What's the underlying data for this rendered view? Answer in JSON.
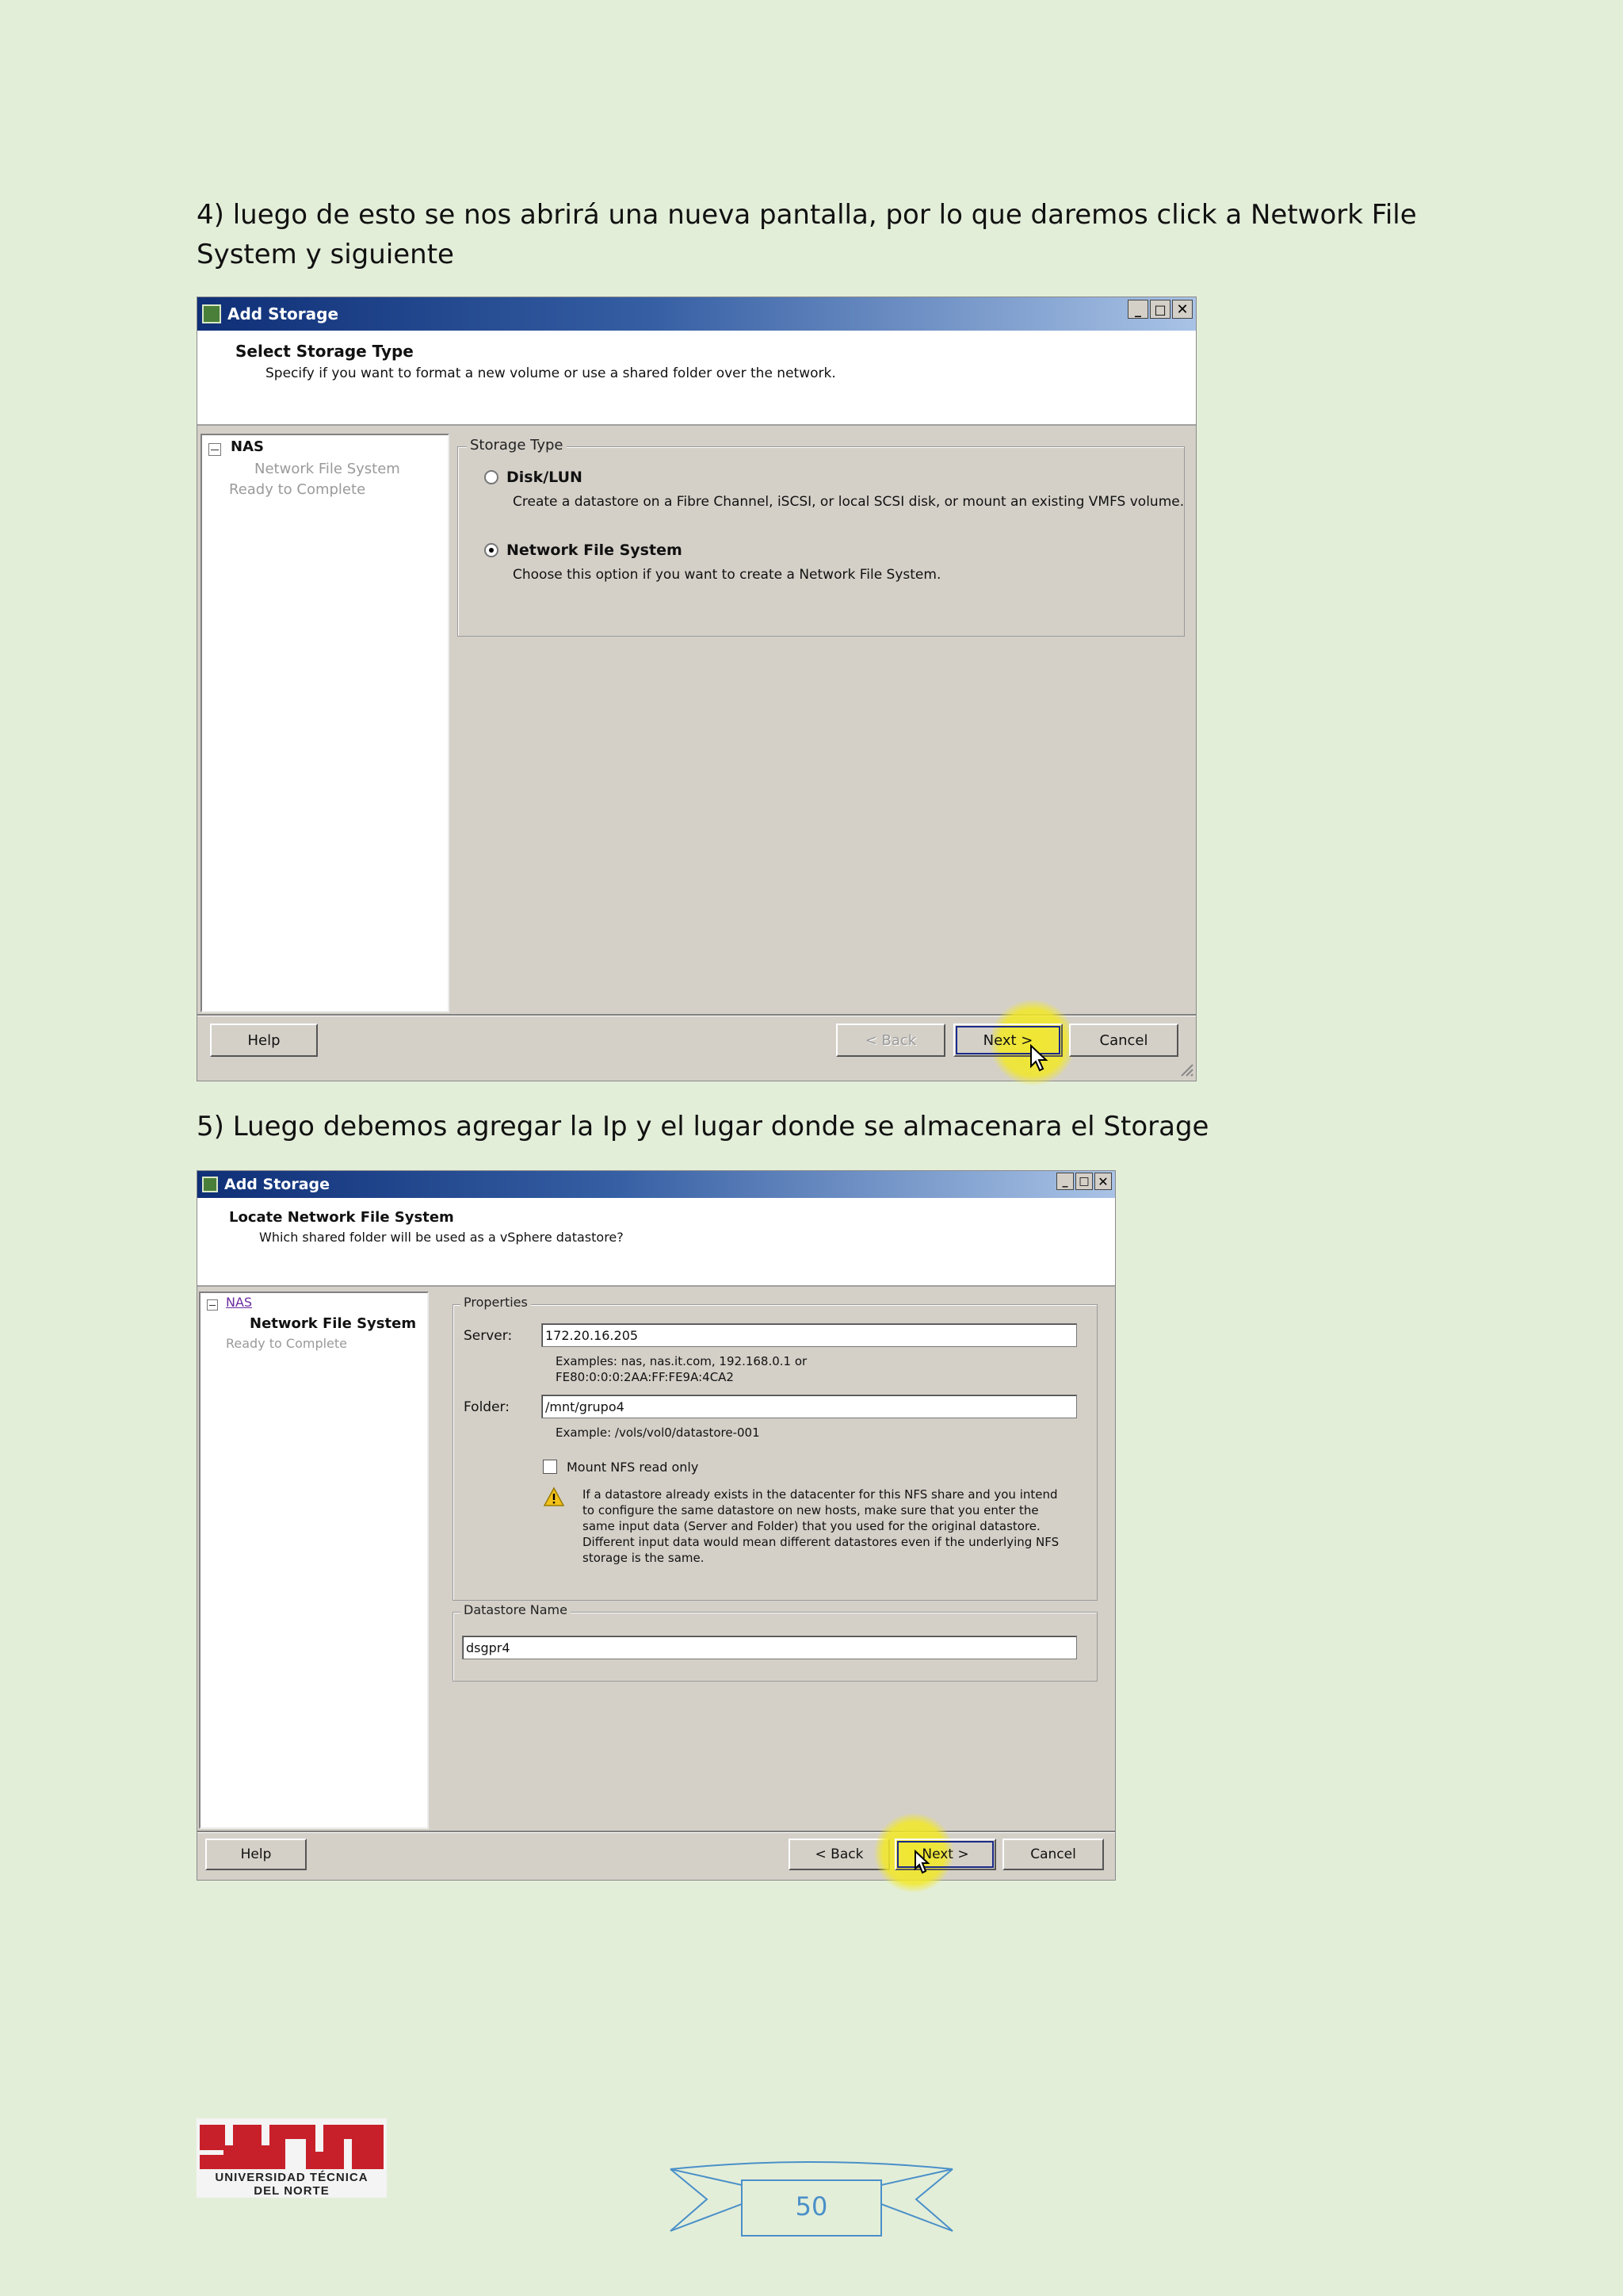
{
  "step4_text": "4) luego de esto se nos abrirá una nueva pantalla, por lo que daremos click a Network File System y siguiente",
  "step5_text": "5) Luego debemos agregar la Ip y el lugar donde se almacenara el Storage",
  "dialog1": {
    "title": "Add Storage",
    "header_title": "Select Storage Type",
    "header_subtitle": "Specify if you want to format a new volume or use a shared folder over the network.",
    "nav": {
      "root": "NAS",
      "current": "Network File System",
      "next": "Ready to Complete"
    },
    "group_label": "Storage Type",
    "options": [
      {
        "label": "Disk/LUN",
        "description": "Create a datastore on a Fibre Channel, iSCSI, or local SCSI disk, or mount an existing VMFS volume.",
        "selected": false
      },
      {
        "label": "Network File System",
        "description": "Choose this option if you want to create a Network File System.",
        "selected": true
      }
    ],
    "buttons": {
      "help": "Help",
      "back": "< Back",
      "next": "Next >",
      "cancel": "Cancel"
    }
  },
  "dialog2": {
    "title": "Add Storage",
    "header_title": "Locate Network File System",
    "header_subtitle": "Which shared folder will be used as a vSphere datastore?",
    "nav": {
      "root": "NAS",
      "current": "Network File System",
      "next": "Ready to Complete"
    },
    "properties_label": "Properties",
    "server_label": "Server:",
    "server_value": "172.20.16.205",
    "server_hint_1": "Examples: nas, nas.it.com, 192.168.0.1 or",
    "server_hint_2": "FE80:0:0:0:2AA:FF:FE9A:4CA2",
    "folder_label": "Folder:",
    "folder_value": "/mnt/grupo4",
    "folder_hint": "Example: /vols/vol0/datastore-001",
    "readonly_label": "Mount NFS read only",
    "warning_lines": [
      "If a datastore already exists in the datacenter for this NFS share and you intend",
      "to configure the same datastore on new hosts, make sure that you enter the",
      "same input data (Server and Folder) that you used for the original datastore.",
      "Different input data would mean different datastores even if the underlying NFS",
      "storage is the same."
    ],
    "datastore_label": "Datastore Name",
    "datastore_value": "dsgpr4",
    "buttons": {
      "help": "Help",
      "back": "< Back",
      "next": "Next >",
      "cancel": "Cancel"
    }
  },
  "footer": {
    "logo_line1": "UNIVERSIDAD TÉCNICA",
    "logo_line2": "DEL NORTE",
    "page_number": "50"
  },
  "colors": {
    "page_bg": "#e3eed9",
    "logo_red": "#c8202a",
    "banner_blue": "#4a90c8",
    "highlight": "#f2e828"
  }
}
